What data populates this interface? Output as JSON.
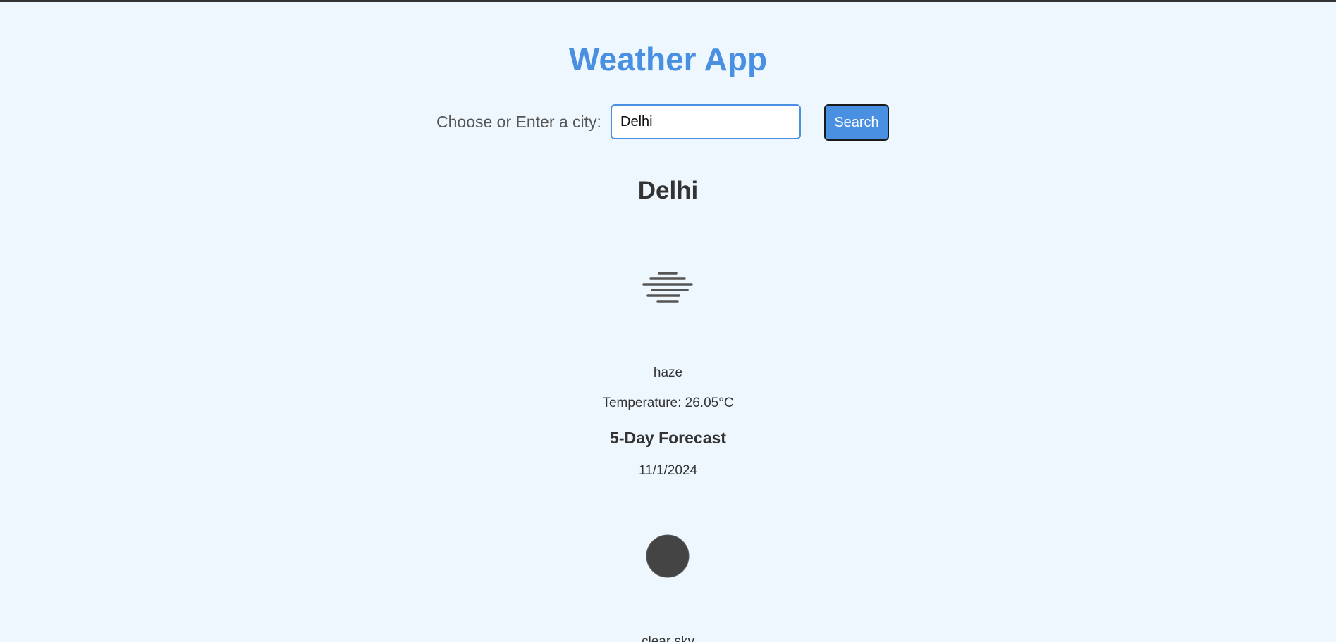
{
  "app": {
    "title": "Weather App"
  },
  "search": {
    "label": "Choose or Enter a city:",
    "input_value": "Delhi",
    "button_label": "Search"
  },
  "current": {
    "city": "Delhi",
    "icon": "haze-icon",
    "description": "haze",
    "temperature": "Temperature: 26.05°C"
  },
  "forecast": {
    "title": "5-Day Forecast",
    "days": [
      {
        "date": "11/1/2024",
        "icon": "clear-sky-icon",
        "description": "clear sky"
      }
    ]
  },
  "colors": {
    "background": "#eef7fd",
    "accent": "#4a90e2",
    "text": "#333333"
  }
}
